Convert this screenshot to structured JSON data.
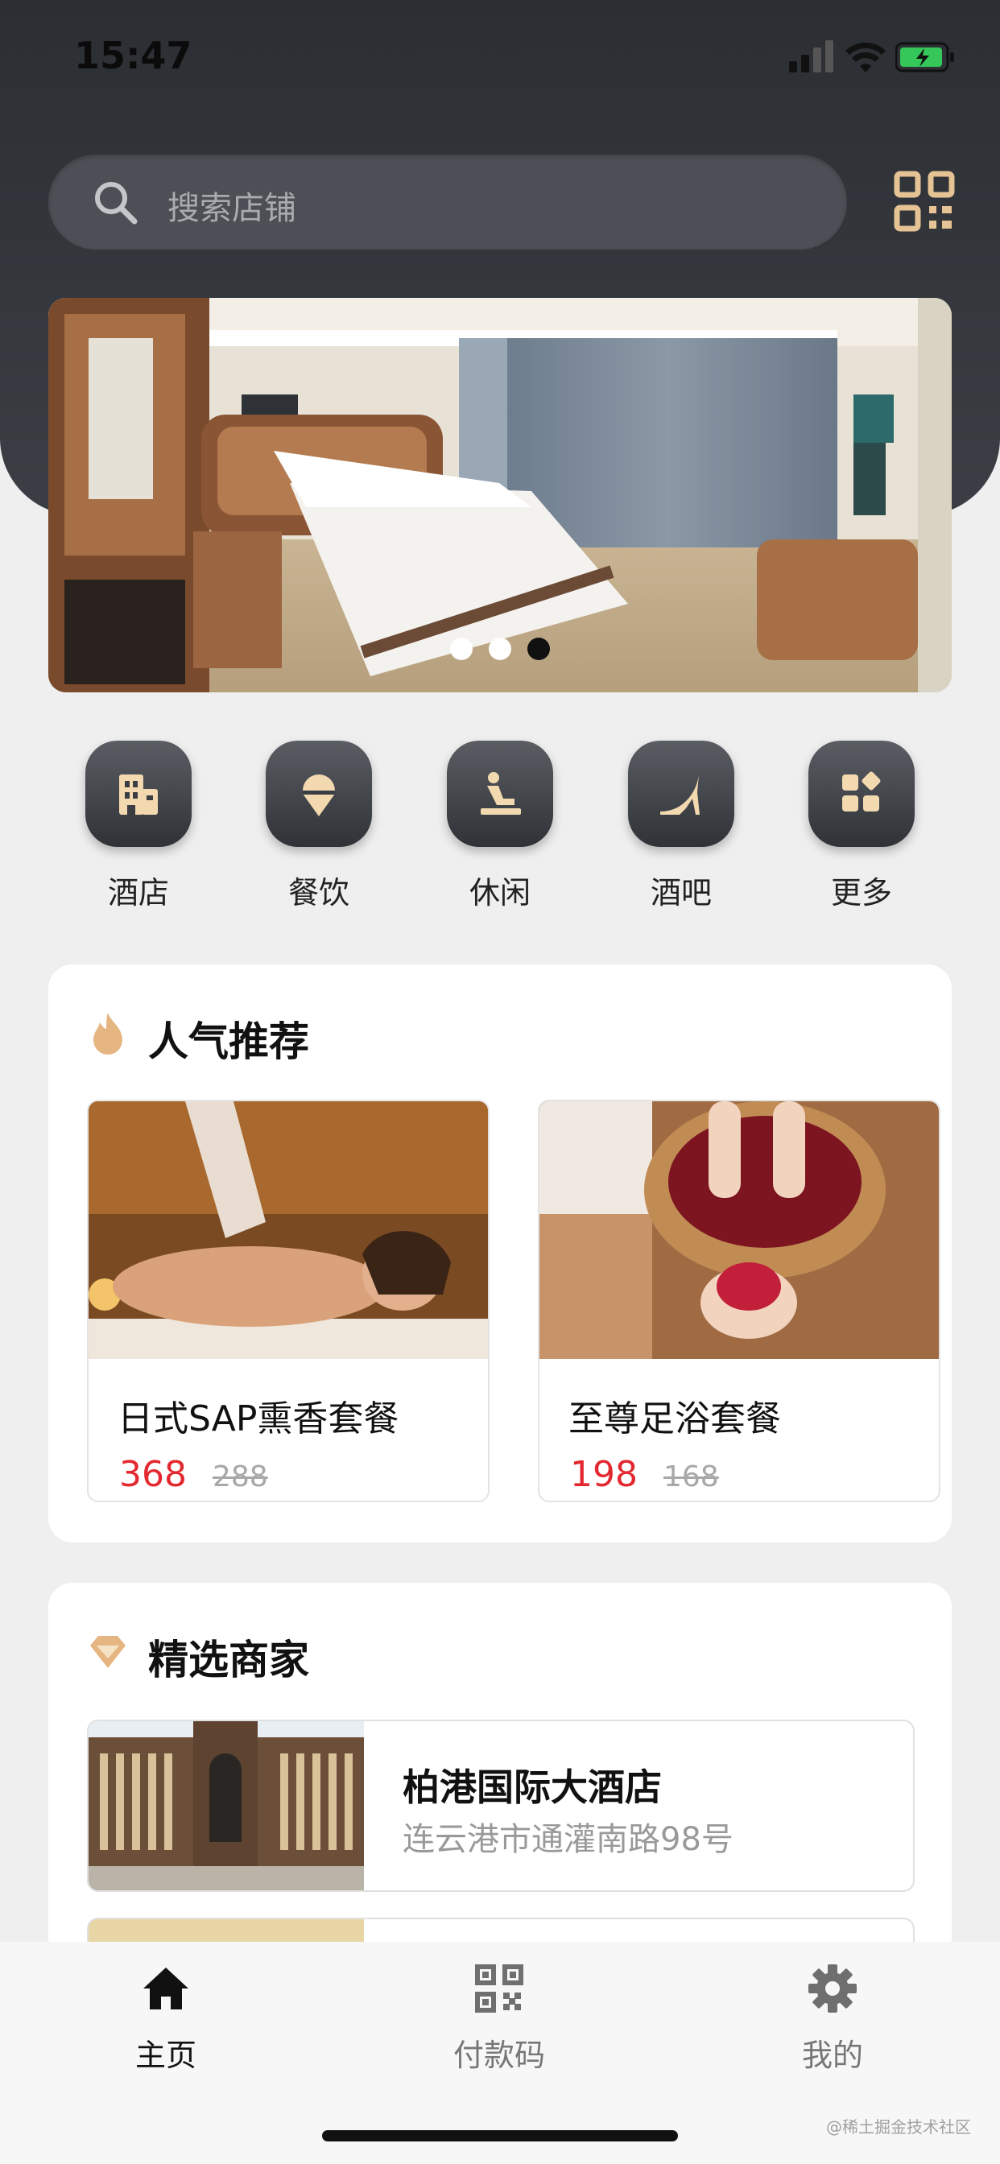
{
  "status_bar": {
    "time": "15:47"
  },
  "search": {
    "placeholder": "搜索店铺"
  },
  "banner": {
    "active_index": 2,
    "dot_count": 3
  },
  "categories": [
    {
      "label": "酒店",
      "icon": "building-icon"
    },
    {
      "label": "餐饮",
      "icon": "ice-cream-icon"
    },
    {
      "label": "休闲",
      "icon": "massage-icon"
    },
    {
      "label": "酒吧",
      "icon": "high-heel-icon"
    },
    {
      "label": "更多",
      "icon": "grid-more-icon"
    }
  ],
  "recommend": {
    "title": "人气推荐",
    "items": [
      {
        "name": "日式SAP熏香套餐",
        "price": "368",
        "old_price": "288"
      },
      {
        "name": "至尊足浴套餐",
        "price": "198",
        "old_price": "168"
      }
    ]
  },
  "merchants": {
    "title": "精选商家",
    "items": [
      {
        "name": "柏港国际大酒店",
        "address": "连云港市通灌南路98号"
      }
    ]
  },
  "tabbar": {
    "items": [
      {
        "label": "主页",
        "icon": "home-icon",
        "active": true
      },
      {
        "label": "付款码",
        "icon": "qr-code-icon",
        "active": false
      },
      {
        "label": "我的",
        "icon": "gear-icon",
        "active": false
      }
    ]
  },
  "watermark": "@稀土掘金技术社区",
  "colors": {
    "accent_gold": "#e6c394",
    "price_red": "#e3282f",
    "header_dark": "#2b2e33"
  }
}
